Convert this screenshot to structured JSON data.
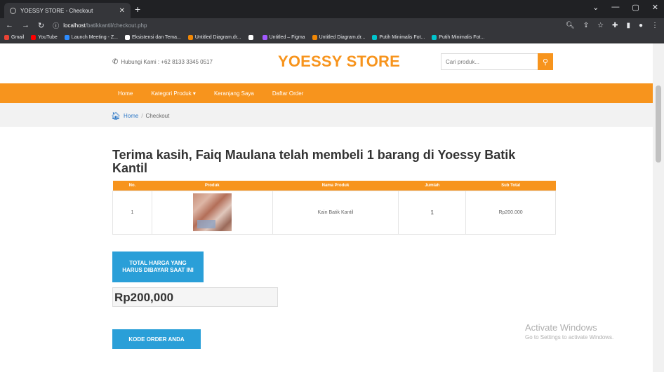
{
  "browser": {
    "tab_title": "YOESSY STORE - Checkout",
    "new_tab": "+",
    "url_host": "localhost",
    "url_path": "/batikkantil/checkout.php",
    "bookmarks": [
      {
        "label": "Gmail",
        "color": "#ea4335"
      },
      {
        "label": "YouTube",
        "color": "#ff0000"
      },
      {
        "label": "Launch Meeting - Z...",
        "color": "#2d8cff"
      },
      {
        "label": "Eksistensi dan Tema...",
        "color": "#ffffff"
      },
      {
        "label": "Untitled Diagram.dr...",
        "color": "#f08705"
      },
      {
        "label": "",
        "color": "#ffffff"
      },
      {
        "label": "Untitled – Figma",
        "color": "#a259ff"
      },
      {
        "label": "Untitled Diagram.dr...",
        "color": "#f08705"
      },
      {
        "label": "Putih Minimalis Fot...",
        "color": "#00c4cc"
      },
      {
        "label": "Putih Minimalis Fot...",
        "color": "#00c4cc"
      }
    ]
  },
  "header": {
    "phone_label": "Hubungi Kami : +62 8133 3345 0517",
    "brand": "YOESSY STORE",
    "search_placeholder": "Cari produk..."
  },
  "nav": {
    "items": [
      "Home",
      "Kategori Produk ▾",
      "Keranjang Saya",
      "Daftar Order"
    ]
  },
  "breadcrumb": {
    "home": "Home",
    "separator": "/",
    "current": "Checkout"
  },
  "main": {
    "thanks_message": "Terima kasih, Faiq Maulana telah membeli 1 barang di Yoessy Batik Kantil",
    "table": {
      "headers": [
        "No.",
        "Produk",
        "Nama Produk",
        "Jumlah",
        "Sub Total"
      ],
      "rows": [
        {
          "no": "1",
          "product_image": "batik-product-image",
          "name": "Kain Batik Kantil",
          "qty": "1",
          "subtotal": "Rp200.000"
        }
      ]
    },
    "total_button": "TOTAL HARGA YANG HARUS DIBAYAR SAAT INI",
    "total_value": "Rp200,000",
    "order_code_button": "KODE ORDER ANDA"
  },
  "watermark": {
    "title": "Activate Windows",
    "subtitle": "Go to Settings to activate Windows."
  },
  "colors": {
    "accent": "#f7941d",
    "button": "#2a9fd8"
  }
}
